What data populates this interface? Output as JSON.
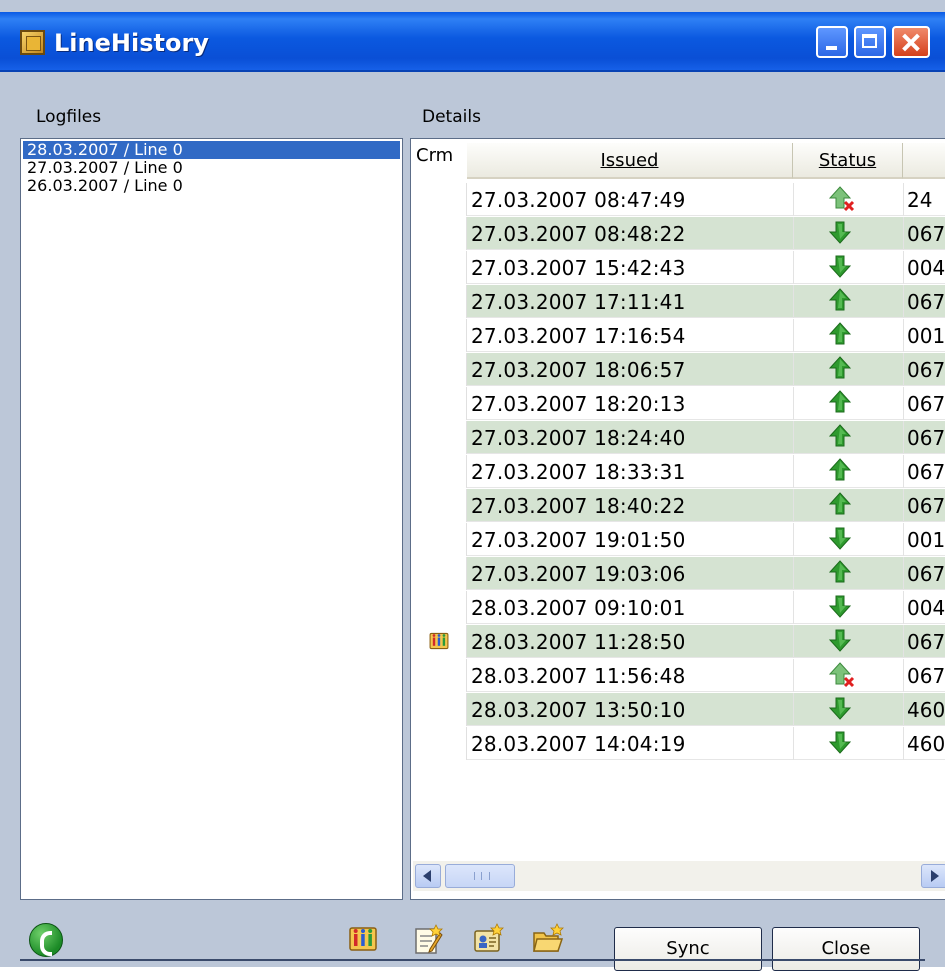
{
  "window": {
    "title": "LineHistory"
  },
  "labels": {
    "logfiles": "Logfiles",
    "details": "Details"
  },
  "logfiles": [
    {
      "label": "28.03.2007 / Line 0",
      "selected": true
    },
    {
      "label": "27.03.2007 / Line 0",
      "selected": false
    },
    {
      "label": "26.03.2007 / Line 0",
      "selected": false
    }
  ],
  "details": {
    "columns": {
      "crm": "Crm",
      "issued": "Issued",
      "status": "Status",
      "extra": ""
    },
    "rows": [
      {
        "crm": "",
        "issued": "27.03.2007 08:47:49",
        "status": "outgoing-failed",
        "extra": "24"
      },
      {
        "crm": "",
        "issued": "27.03.2007 08:48:22",
        "status": "incoming",
        "extra": "067"
      },
      {
        "crm": "",
        "issued": "27.03.2007 15:42:43",
        "status": "incoming",
        "extra": "004"
      },
      {
        "crm": "",
        "issued": "27.03.2007 17:11:41",
        "status": "outgoing",
        "extra": "067"
      },
      {
        "crm": "",
        "issued": "27.03.2007 17:16:54",
        "status": "outgoing",
        "extra": "001"
      },
      {
        "crm": "",
        "issued": "27.03.2007 18:06:57",
        "status": "outgoing",
        "extra": "067"
      },
      {
        "crm": "",
        "issued": "27.03.2007 18:20:13",
        "status": "outgoing",
        "extra": "067"
      },
      {
        "crm": "",
        "issued": "27.03.2007 18:24:40",
        "status": "outgoing",
        "extra": "067"
      },
      {
        "crm": "",
        "issued": "27.03.2007 18:33:31",
        "status": "outgoing",
        "extra": "067"
      },
      {
        "crm": "",
        "issued": "27.03.2007 18:40:22",
        "status": "outgoing",
        "extra": "067"
      },
      {
        "crm": "",
        "issued": "27.03.2007 19:01:50",
        "status": "incoming",
        "extra": "001"
      },
      {
        "crm": "",
        "issued": "27.03.2007 19:03:06",
        "status": "outgoing",
        "extra": "067"
      },
      {
        "crm": "",
        "issued": "28.03.2007 09:10:01",
        "status": "incoming",
        "extra": "004"
      },
      {
        "crm": "crm-icon",
        "issued": "28.03.2007 11:28:50",
        "status": "incoming",
        "extra": "067"
      },
      {
        "crm": "",
        "issued": "28.03.2007 11:56:48",
        "status": "outgoing-failed",
        "extra": "067"
      },
      {
        "crm": "",
        "issued": "28.03.2007 13:50:10",
        "status": "incoming",
        "extra": "460"
      },
      {
        "crm": "",
        "issued": "28.03.2007 14:04:19",
        "status": "incoming",
        "extra": "460"
      }
    ]
  },
  "scrollbar": {
    "left_icon": "scroll-left-icon",
    "right_icon": "scroll-right-icon"
  },
  "toolbar": {
    "icons": [
      "phone-icon",
      "crm-icon",
      "note-icon",
      "contact-card-icon",
      "folder-icon"
    ],
    "sync_label": "Sync",
    "close_label": "Close"
  },
  "colors": {
    "title_bar": "#0a59e0",
    "window_bg": "#bcc7d8",
    "selection": "#316ac5",
    "row_alt": "#d5e3d2",
    "arrow_green": "#2e9a2e"
  }
}
